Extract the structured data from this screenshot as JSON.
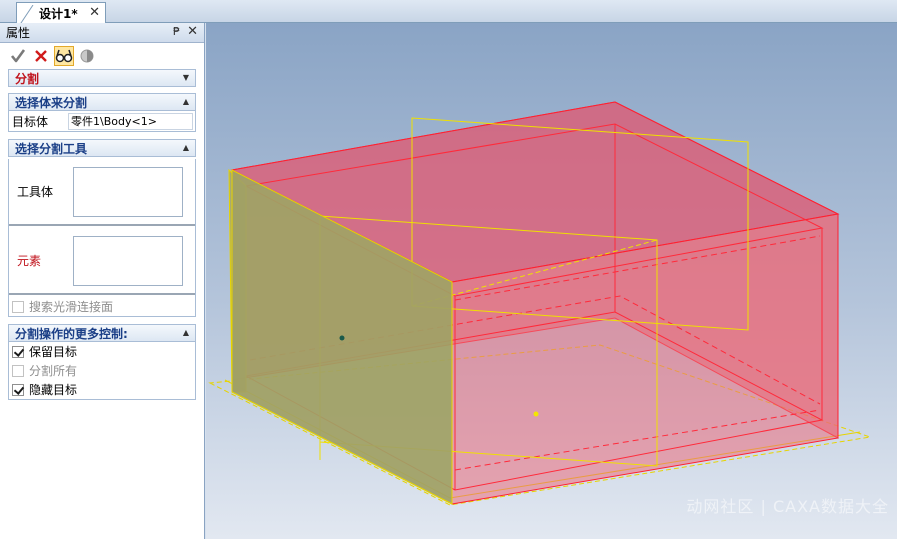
{
  "tab": {
    "title": "设计1*",
    "close": "✕"
  },
  "panel": {
    "title": "属性",
    "pin": "₱",
    "close": "✕",
    "toolbar": {
      "ok_icon": "check-icon",
      "cancel_icon": "x-icon",
      "preview_icon": "glasses-icon",
      "option_icon": "half-circle-icon"
    },
    "section_split": {
      "title": "分割"
    },
    "section_body": {
      "title": "选择体来分割",
      "target_label": "目标体",
      "target_value": "零件1\\Body<1>"
    },
    "section_tools": {
      "title": "选择分割工具",
      "tool_body_label": "工具体",
      "element_label": "元素",
      "smooth_label": "搜索光滑连接面"
    },
    "section_more": {
      "title": "分割操作的更多控制:",
      "keep_target": "保留目标",
      "split_all": "分割所有",
      "hide_target": "隐藏目标"
    }
  },
  "viewport": {
    "watermark": "动网社区 | CAXA数据大全"
  },
  "colors": {
    "accent_red": "#c0121b",
    "navy": "#1b3f87",
    "body_fill": "#e86070",
    "tool_fill": "#a9a86a"
  }
}
